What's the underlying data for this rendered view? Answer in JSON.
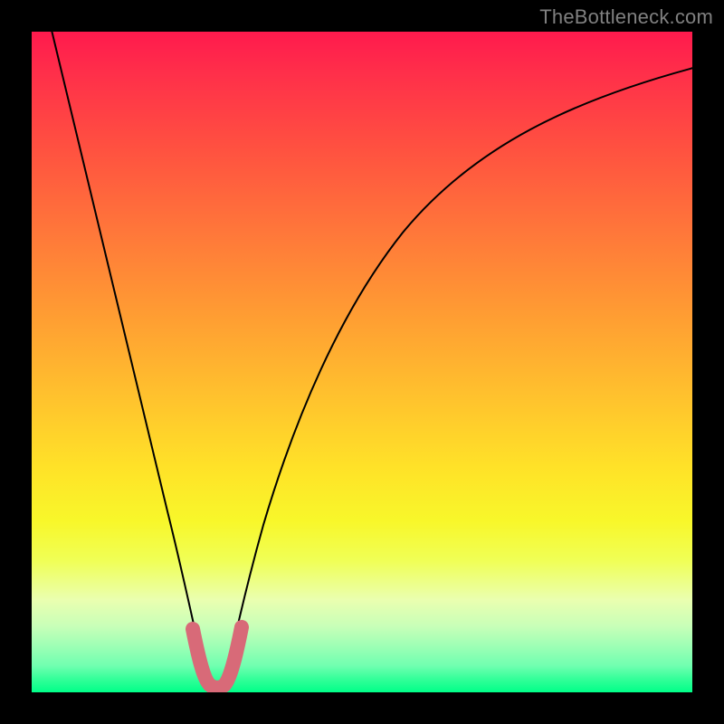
{
  "watermark": "TheBottleneck.com",
  "colors": {
    "frame": "#000000",
    "curve": "#000000",
    "highlight": "#d86a78",
    "gradient_top": "#ff1a4d",
    "gradient_bottom": "#00ff88"
  },
  "chart_data": {
    "type": "line",
    "title": "",
    "xlabel": "",
    "ylabel": "",
    "xlim": [
      0,
      100
    ],
    "ylim": [
      0,
      100
    ],
    "x": [
      0,
      5,
      10,
      15,
      18,
      20,
      22,
      24,
      25,
      26,
      27,
      28,
      29,
      30,
      31,
      33,
      36,
      40,
      45,
      50,
      55,
      60,
      65,
      70,
      75,
      80,
      85,
      90,
      95,
      100
    ],
    "series": [
      {
        "name": "bottleneck-curve",
        "values": [
          100,
          82,
          64,
          42,
          28,
          18,
          9,
          4,
          2,
          1,
          0.5,
          0.5,
          1,
          2,
          4,
          9,
          17,
          27,
          38,
          47,
          55,
          61,
          67,
          72,
          76,
          80,
          83,
          86,
          88,
          90
        ]
      }
    ],
    "highlight_range_x": [
      24,
      30
    ],
    "gradient_stops": [
      {
        "pos": 0,
        "color": "#ff1a4d"
      },
      {
        "pos": 6,
        "color": "#ff2e4a"
      },
      {
        "pos": 18,
        "color": "#ff5240"
      },
      {
        "pos": 30,
        "color": "#ff763a"
      },
      {
        "pos": 42,
        "color": "#ff9a33"
      },
      {
        "pos": 54,
        "color": "#ffbe2e"
      },
      {
        "pos": 66,
        "color": "#ffe228"
      },
      {
        "pos": 74,
        "color": "#f8f72a"
      },
      {
        "pos": 80,
        "color": "#f0ff55"
      },
      {
        "pos": 86,
        "color": "#eaffb0"
      },
      {
        "pos": 90,
        "color": "#c8ffb8"
      },
      {
        "pos": 93,
        "color": "#9dffb5"
      },
      {
        "pos": 96,
        "color": "#70ffb0"
      },
      {
        "pos": 98,
        "color": "#33ff99"
      },
      {
        "pos": 100,
        "color": "#00ff88"
      }
    ]
  }
}
